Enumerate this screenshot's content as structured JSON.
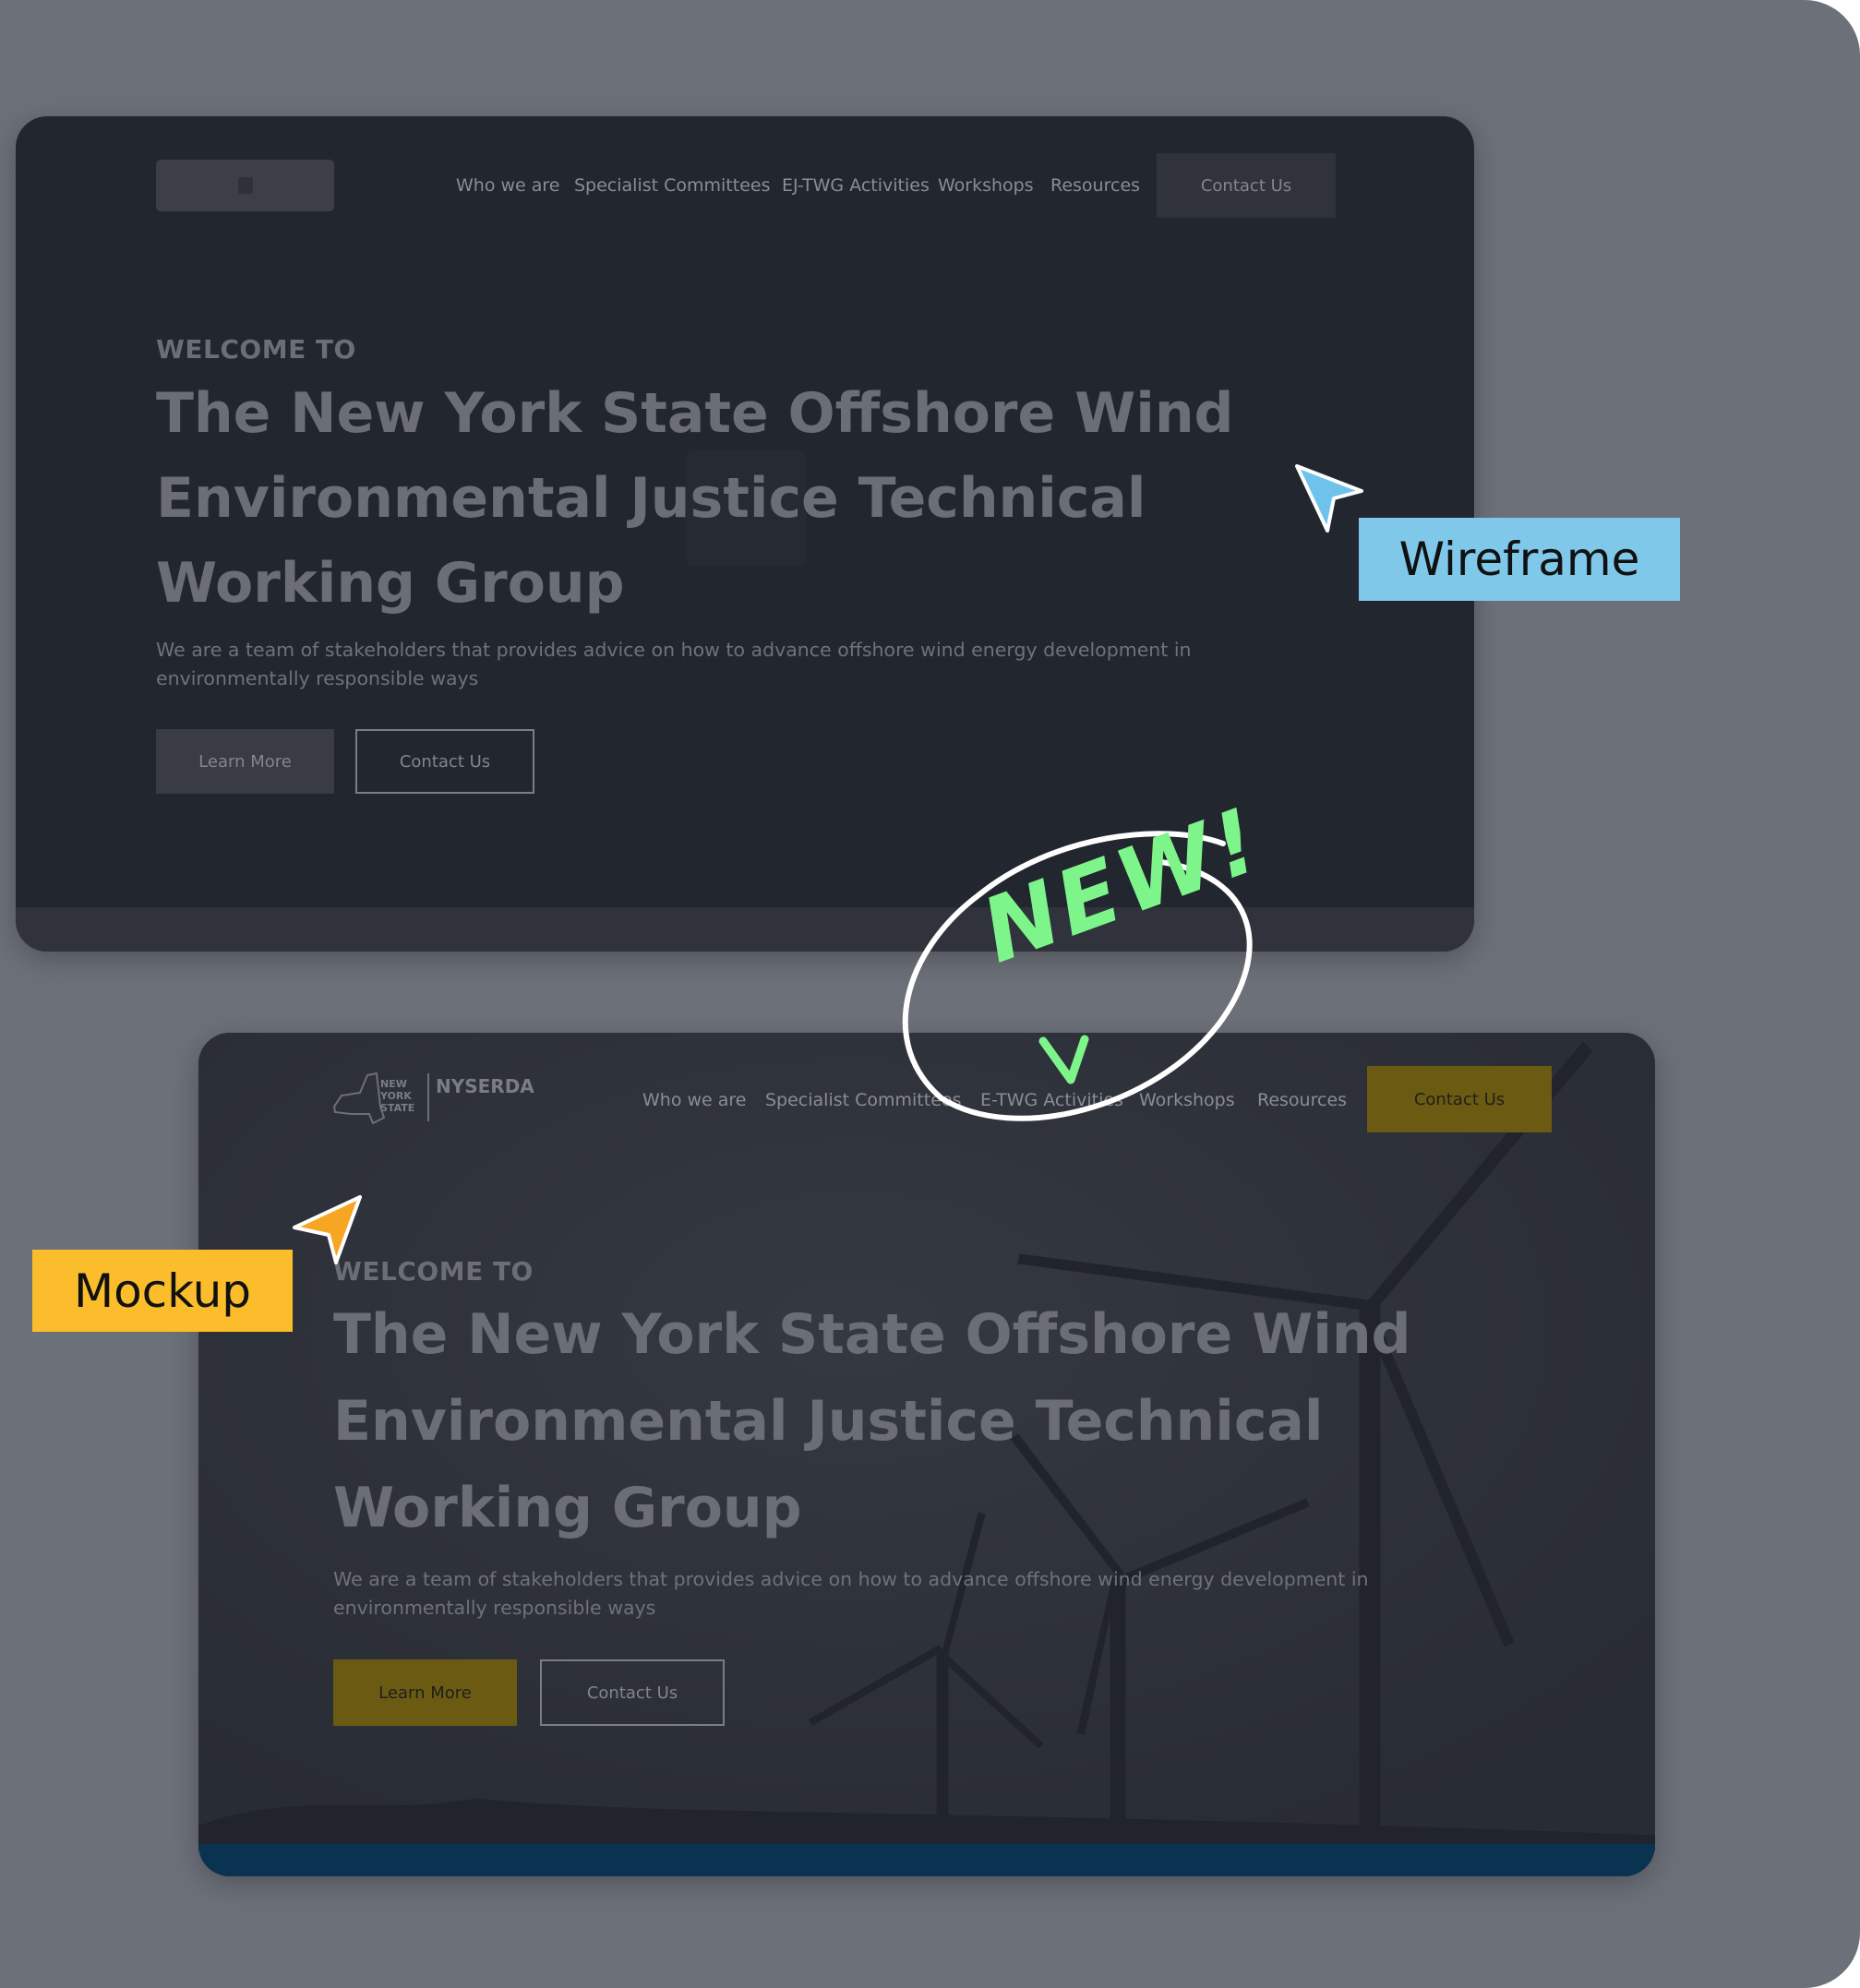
{
  "wireframe": {
    "nav": [
      "Who we are",
      "Specialist Committees",
      "EJ-TWG Activities",
      "Workshops",
      "Resources"
    ],
    "contact_button": "Contact Us",
    "welcome": "WELCOME TO",
    "title_lines": [
      "The New York State Offshore Wind",
      "Environmental Justice Technical",
      "Working Group"
    ],
    "description_lines": [
      "We are a team of stakeholders that provides advice on how to advance offshore wind energy development in",
      "environmentally responsible ways"
    ],
    "learn_more": "Learn More",
    "contact_us": "Contact Us"
  },
  "mockup": {
    "logo": {
      "state": "NEW YORK STATE",
      "brand": "NYSERDA"
    },
    "nav": [
      "Who we are",
      "Specialist Committees",
      "E-TWG Activities",
      "Workshops",
      "Resources"
    ],
    "contact_button": "Contact Us",
    "welcome": "WELCOME TO",
    "title_lines": [
      "The New York State Offshore Wind",
      "Environmental Justice Technical",
      "Working Group"
    ],
    "description_lines": [
      "We are a team of stakeholders that provides advice on how to advance offshore wind energy development in",
      "environmentally responsible ways"
    ],
    "learn_more": "Learn More",
    "contact_us": "Contact Us",
    "accent": "#6b5a12"
  },
  "labels": {
    "wireframe": "Wireframe",
    "mockup": "Mockup",
    "new": "NEW!"
  },
  "colors": {
    "wireframe_label": "#7fc8ea",
    "mockup_label": "#fbbd2b",
    "new_annotation": "#7ef58a"
  }
}
